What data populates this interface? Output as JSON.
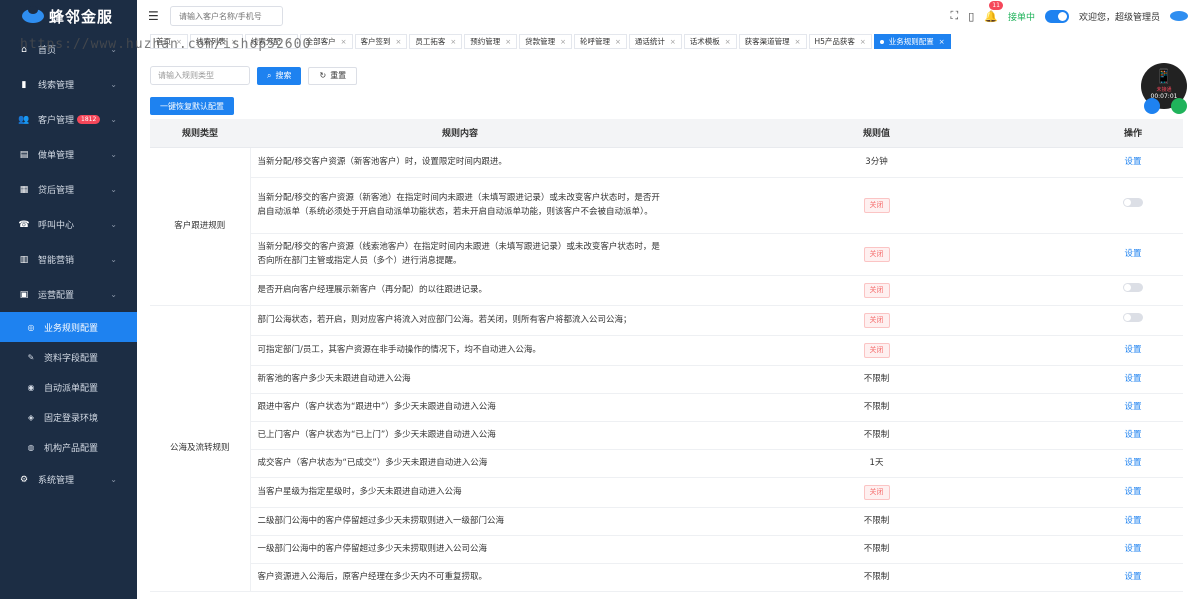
{
  "app": {
    "logo_text": "蜂邻金服",
    "watermark": "https://www.huzhan.com/ishop52600"
  },
  "sidebar": {
    "items": [
      {
        "label": "首页",
        "icon": "home-icon",
        "glyph": "⌂"
      },
      {
        "label": "线索管理",
        "icon": "clue-icon",
        "glyph": "▮"
      },
      {
        "label": "客户管理",
        "icon": "customer-icon",
        "glyph": "👥",
        "badge": "1812"
      },
      {
        "label": "做单管理",
        "icon": "order-icon",
        "glyph": "▤"
      },
      {
        "label": "贷后管理",
        "icon": "loan-icon",
        "glyph": "▦"
      },
      {
        "label": "呼叫中心",
        "icon": "call-icon",
        "glyph": "☎"
      },
      {
        "label": "智能营销",
        "icon": "marketing-icon",
        "glyph": "▥"
      },
      {
        "label": "运营配置",
        "icon": "ops-icon",
        "glyph": "▣"
      }
    ],
    "sub_items": [
      {
        "label": "业务规则配置",
        "icon": "rules-icon",
        "glyph": "◎",
        "active": true
      },
      {
        "label": "资料字段配置",
        "icon": "edit-icon",
        "glyph": "✎"
      },
      {
        "label": "自动派单配置",
        "icon": "auto-dispatch-icon",
        "glyph": "◉"
      },
      {
        "label": "固定登录环境",
        "icon": "shield-icon",
        "glyph": "◈"
      },
      {
        "label": "机构产品配置",
        "icon": "globe-icon",
        "glyph": "◍"
      }
    ],
    "last_item": {
      "label": "系统管理",
      "icon": "settings-icon",
      "glyph": "⚙"
    }
  },
  "header": {
    "search_placeholder": "请输入客户名称/手机号",
    "notification_count": "11",
    "online_status": "接单中",
    "welcome": "欢迎您，超级管理员"
  },
  "tabs": [
    {
      "label": "首页"
    },
    {
      "label": "线索列表"
    },
    {
      "label": "线索分配"
    },
    {
      "label": "全部客户"
    },
    {
      "label": "客户签到"
    },
    {
      "label": "员工拓客"
    },
    {
      "label": "预约管理"
    },
    {
      "label": "贷款管理"
    },
    {
      "label": "轮呼管理"
    },
    {
      "label": "通话统计"
    },
    {
      "label": "话术模板"
    },
    {
      "label": "获客渠道管理"
    },
    {
      "label": "H5产品获客"
    },
    {
      "label": "业务规则配置",
      "active": true
    }
  ],
  "filter": {
    "placeholder": "请输入规则类型",
    "search_label": "搜索",
    "reset_label": "重置",
    "restore_label": "一键恢复默认配置"
  },
  "phone": {
    "status": "未接通",
    "time": "00:07:01"
  },
  "table": {
    "headers": [
      "规则类型",
      "规则内容",
      "规则值",
      "操作"
    ],
    "groups": [
      {
        "category": "客户跟进规则",
        "rows": [
          {
            "content": "当新分配/移交客户资源（新客池客户）时，设置限定时间内跟进。",
            "value": "3分钟",
            "value_type": "text",
            "action": "设置",
            "action_type": "link"
          },
          {
            "content": "当新分配/移交的客户资源（新客池）在指定时间内未跟进（未填写跟进记录）或未改变客户状态时，是否开启自动派单（系统必须处于开启自动派单功能状态，若未开启自动派单功能，则该客户不会被自动派单）。",
            "value": "关闭",
            "value_type": "tag",
            "action": "",
            "action_type": "switch"
          },
          {
            "content": "当新分配/移交的客户资源（线索池客户）在指定时间内未跟进（未填写跟进记录）或未改变客户状态时，是否向所在部门主管或指定人员（多个）进行消息提醒。",
            "value": "关闭",
            "value_type": "tag",
            "action": "设置",
            "action_type": "link"
          },
          {
            "content": "是否开启向客户经理展示新客户（再分配）的以往跟进记录。",
            "value": "关闭",
            "value_type": "tag",
            "action": "",
            "action_type": "switch"
          }
        ]
      },
      {
        "category": "公海及流转规则",
        "rows": [
          {
            "content": "部门公海状态，若开启，则对应客户将流入对应部门公海。若关闭，则所有客户将都流入公司公海；",
            "value": "关闭",
            "value_type": "tag",
            "action": "",
            "action_type": "switch"
          },
          {
            "content": "可指定部门/员工，其客户资源在非手动操作的情况下，均不自动进入公海。",
            "value": "关闭",
            "value_type": "tag",
            "action": "设置",
            "action_type": "link"
          },
          {
            "content": "新客池的客户多少天未跟进自动进入公海",
            "value": "不限制",
            "value_type": "text",
            "action": "设置",
            "action_type": "link"
          },
          {
            "content": "跟进中客户（客户状态为“跟进中”）多少天未跟进自动进入公海",
            "value": "不限制",
            "value_type": "text",
            "action": "设置",
            "action_type": "link"
          },
          {
            "content": "已上门客户（客户状态为“已上门”）多少天未跟进自动进入公海",
            "value": "不限制",
            "value_type": "text",
            "action": "设置",
            "action_type": "link"
          },
          {
            "content": "成交客户（客户状态为“已成交”）多少天未跟进自动进入公海",
            "value": "1天",
            "value_type": "text",
            "action": "设置",
            "action_type": "link"
          },
          {
            "content": "当客户星级为指定星级时，多少天未跟进自动进入公海",
            "value": "关闭",
            "value_type": "tag",
            "action": "设置",
            "action_type": "link"
          },
          {
            "content": "二级部门公海中的客户停留超过多少天未捞取则进入一级部门公海",
            "value": "不限制",
            "value_type": "text",
            "action": "设置",
            "action_type": "link"
          },
          {
            "content": "一级部门公海中的客户停留超过多少天未捞取则进入公司公海",
            "value": "不限制",
            "value_type": "text",
            "action": "设置",
            "action_type": "link"
          },
          {
            "content": "客户资源进入公海后，原客户经理在多少天内不可重复捞取。",
            "value": "不限制",
            "value_type": "text",
            "action": "设置",
            "action_type": "link"
          }
        ]
      }
    ]
  }
}
